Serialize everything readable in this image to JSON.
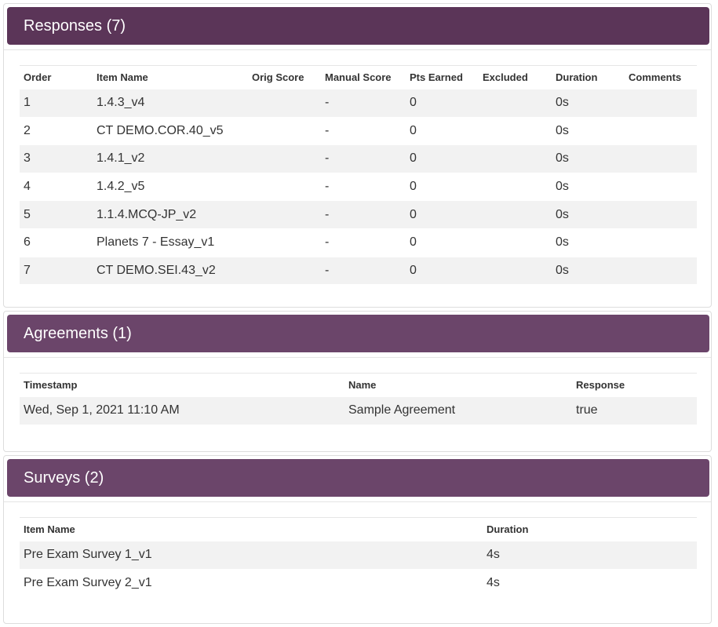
{
  "responses": {
    "title": "Responses (7)",
    "columns": [
      "Order",
      "Item Name",
      "Orig Score",
      "Manual Score",
      "Pts Earned",
      "Excluded",
      "Duration",
      "Comments"
    ],
    "rows": [
      [
        "1",
        "1.4.3_v4",
        "",
        "-",
        "0",
        "",
        "0s",
        ""
      ],
      [
        "2",
        "CT DEMO.COR.40_v5",
        "",
        "-",
        "0",
        "",
        "0s",
        ""
      ],
      [
        "3",
        "1.4.1_v2",
        "",
        "-",
        "0",
        "",
        "0s",
        ""
      ],
      [
        "4",
        "1.4.2_v5",
        "",
        "-",
        "0",
        "",
        "0s",
        ""
      ],
      [
        "5",
        "1.1.4.MCQ-JP_v2",
        "",
        "-",
        "0",
        "",
        "0s",
        ""
      ],
      [
        "6",
        "Planets 7 - Essay_v1",
        "",
        "-",
        "0",
        "",
        "0s",
        ""
      ],
      [
        "7",
        "CT DEMO.SEI.43_v2",
        "",
        "-",
        "0",
        "",
        "0s",
        ""
      ]
    ]
  },
  "agreements": {
    "title": "Agreements (1)",
    "columns": [
      "Timestamp",
      "Name",
      "Response"
    ],
    "rows": [
      [
        "Wed, Sep 1, 2021 11:10 AM",
        "Sample Agreement",
        "true"
      ]
    ]
  },
  "surveys": {
    "title": "Surveys (2)",
    "columns": [
      "Item Name",
      "Duration"
    ],
    "rows": [
      [
        "Pre Exam Survey 1_v1",
        "4s"
      ],
      [
        "Pre Exam Survey 2_v1",
        "4s"
      ]
    ]
  },
  "colors": {
    "heading_primary": "#5b3558",
    "heading_secondary": "#6b456a",
    "row_stripe": "#f2f2f2"
  }
}
